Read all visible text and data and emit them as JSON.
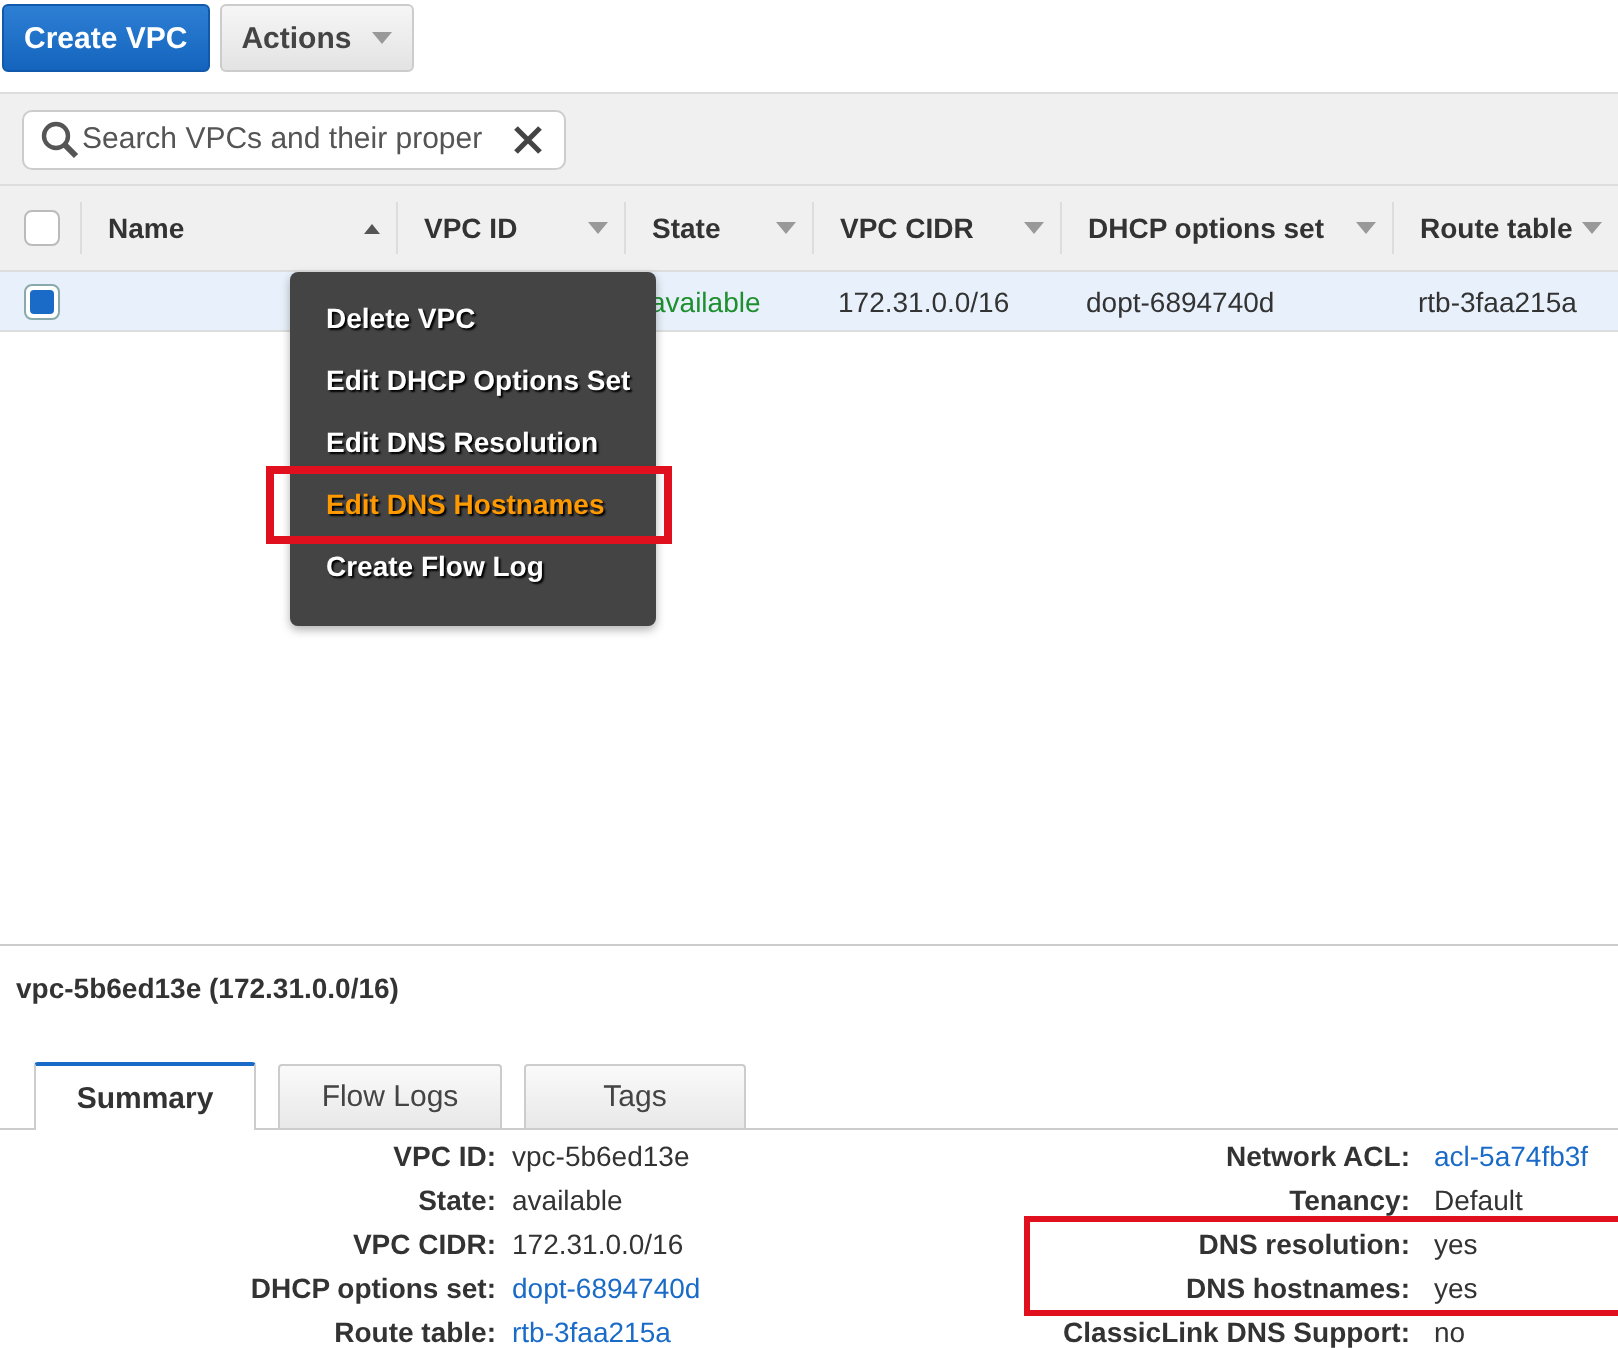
{
  "toolbar": {
    "buttons": [
      {
        "label": "Create VPC",
        "kind": "primary"
      },
      {
        "label": "Actions",
        "kind": "dropdown"
      }
    ]
  },
  "search": {
    "placeholder": "Search VPCs and their proper"
  },
  "table": {
    "all_selected": false,
    "columns": [
      {
        "label": "Name",
        "sorted": true
      },
      {
        "label": "VPC ID",
        "sorted": false
      },
      {
        "label": "State",
        "sorted": false
      },
      {
        "label": "VPC CIDR",
        "sorted": false
      },
      {
        "label": "DHCP options set",
        "sorted": false
      },
      {
        "label": "Route table",
        "sorted": false
      }
    ],
    "rows": [
      {
        "selected": true,
        "cells": [
          null,
          null,
          {
            "text": "available",
            "kind": "status"
          },
          {
            "text": "172.31.0.0/16",
            "kind": "text"
          },
          {
            "text": "dopt-6894740d",
            "kind": "text"
          },
          {
            "text": "rtb-3faa215a",
            "kind": "text"
          }
        ]
      }
    ]
  },
  "context_menu": {
    "items": [
      {
        "label": "Delete VPC",
        "highlighted": false
      },
      {
        "label": "Edit DHCP Options Set",
        "highlighted": false
      },
      {
        "label": "Edit DNS Resolution",
        "highlighted": false
      },
      {
        "label": "Edit DNS Hostnames",
        "highlighted": true
      },
      {
        "label": "Create Flow Log",
        "highlighted": false
      }
    ]
  },
  "details": {
    "title": "vpc-5b6ed13e (172.31.0.0/16)",
    "tabs": [
      {
        "label": "Summary",
        "selected": true
      },
      {
        "label": "Flow Logs",
        "selected": false
      },
      {
        "label": "Tags",
        "selected": false
      }
    ],
    "left": [
      {
        "label": "VPC ID:",
        "value": "vpc-5b6ed13e",
        "kind": "text"
      },
      {
        "label": "State:",
        "value": "available",
        "kind": "text"
      },
      {
        "label": "VPC CIDR:",
        "value": "172.31.0.0/16",
        "kind": "text"
      },
      {
        "label": "DHCP options set:",
        "value": "dopt-6894740d",
        "kind": "link"
      },
      {
        "label": "Route table:",
        "value": "rtb-3faa215a",
        "kind": "link"
      }
    ],
    "right": [
      {
        "label": "Network ACL:",
        "value": "acl-5a74fb3f",
        "kind": "link",
        "highlighted": false
      },
      {
        "label": "Tenancy:",
        "value": "Default",
        "kind": "text",
        "highlighted": false
      },
      {
        "label": "DNS resolution:",
        "value": "yes",
        "kind": "text",
        "highlighted": true
      },
      {
        "label": "DNS hostnames:",
        "value": "yes",
        "kind": "text",
        "highlighted": true
      },
      {
        "label": "ClassicLink DNS Support:",
        "value": "no",
        "kind": "text",
        "highlighted": false
      }
    ]
  }
}
